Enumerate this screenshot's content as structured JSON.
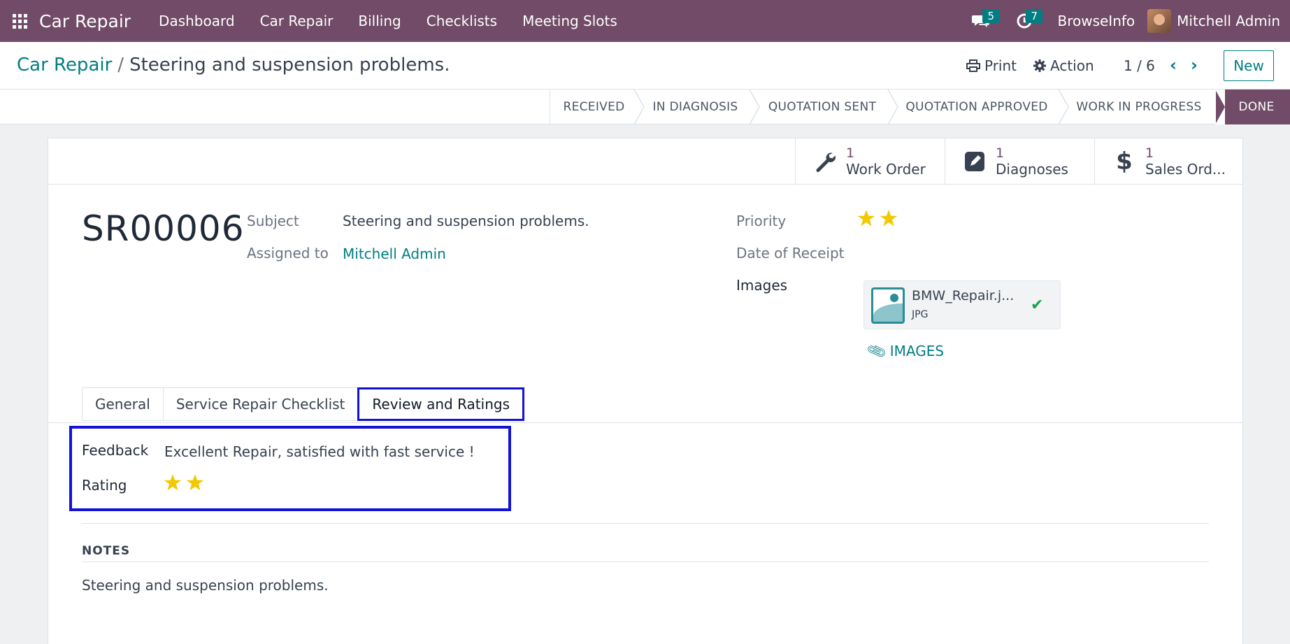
{
  "nav": {
    "brand": "Car Repair",
    "menu": [
      "Dashboard",
      "Car Repair",
      "Billing",
      "Checklists",
      "Meeting Slots"
    ],
    "messages_count": "5",
    "activities_count": "7",
    "company": "BrowseInfo",
    "user": "Mitchell Admin"
  },
  "control": {
    "breadcrumb_root": "Car Repair",
    "breadcrumb_sep": "/",
    "breadcrumb_current": "Steering and suspension problems.",
    "print_label": "Print",
    "action_label": "Action",
    "pager": "1 / 6",
    "new_label": "New"
  },
  "stages": [
    "RECEIVED",
    "IN DIAGNOSIS",
    "QUOTATION SENT",
    "QUOTATION APPROVED",
    "WORK IN PROGRESS",
    "DONE"
  ],
  "active_stage": "DONE",
  "smart_buttons": [
    {
      "value": "1",
      "label": "Work Order",
      "icon": "wrench-icon"
    },
    {
      "value": "1",
      "label": "Diagnoses",
      "icon": "edit-icon"
    },
    {
      "value": "1",
      "label": "Sales Ord...",
      "icon": "dollar-icon"
    }
  ],
  "record": {
    "reference": "SR00006",
    "subject_label": "Subject",
    "subject": "Steering and suspension problems.",
    "assigned_label": "Assigned to",
    "assigned": "Mitchell Admin",
    "priority_label": "Priority",
    "priority_stars": 2,
    "date_label": "Date of Receipt",
    "date": "",
    "images_label": "Images",
    "attachment_name": "BMW_Repair.j...",
    "attachment_type": "JPG",
    "images_button": "IMAGES"
  },
  "tabs": [
    "General",
    "Service Repair Checklist",
    "Review and Ratings"
  ],
  "active_tab": "Review and Ratings",
  "review": {
    "feedback_label": "Feedback",
    "feedback": "Excellent Repair, satisfied with fast service !",
    "rating_label": "Rating",
    "rating_stars": 2
  },
  "notes": {
    "title": "NOTES",
    "text": "Steering and suspension problems."
  },
  "colors": {
    "brand": "#714b67",
    "accent": "#017e84",
    "star": "#f3c800",
    "highlight": "#1212d6"
  }
}
